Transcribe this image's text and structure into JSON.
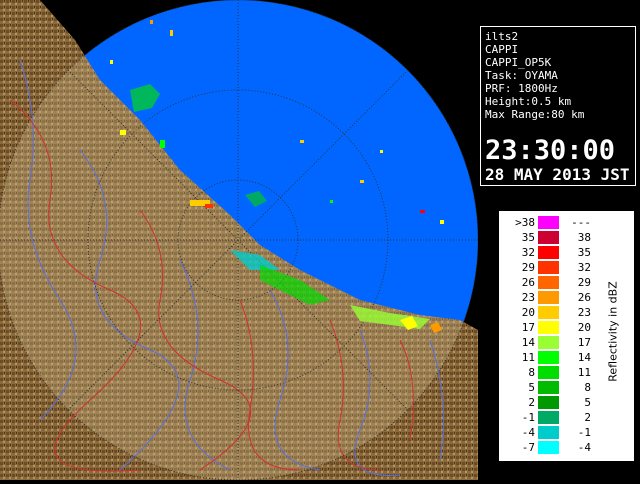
{
  "info": {
    "radar_name": "ilts2",
    "product": "CAPPI",
    "product_code": "CAPPI_OP5K",
    "task": "Task: OYAMA",
    "prf": "PRF: 1800Hz",
    "height": "Height:0.5 km",
    "max_range": "Max Range:80 km",
    "time": "23:30:00",
    "date": "28 MAY 2013 JST"
  },
  "legend": {
    "title": "Reflectivity in dBZ",
    "rows": [
      {
        "lo": ">38",
        "hi": "---",
        "color": "#ff00ff"
      },
      {
        "lo": "35",
        "hi": "38",
        "color": "#cc0033"
      },
      {
        "lo": "32",
        "hi": "35",
        "color": "#ff0000"
      },
      {
        "lo": "29",
        "hi": "32",
        "color": "#ff3300"
      },
      {
        "lo": "26",
        "hi": "29",
        "color": "#ff6600"
      },
      {
        "lo": "23",
        "hi": "26",
        "color": "#ff9900"
      },
      {
        "lo": "20",
        "hi": "23",
        "color": "#ffcc00"
      },
      {
        "lo": "17",
        "hi": "20",
        "color": "#ffff00"
      },
      {
        "lo": "14",
        "hi": "17",
        "color": "#99ff33"
      },
      {
        "lo": "11",
        "hi": "14",
        "color": "#00ff00"
      },
      {
        "lo": "8",
        "hi": "11",
        "color": "#00dd00"
      },
      {
        "lo": "5",
        "hi": "8",
        "color": "#00bb00"
      },
      {
        "lo": "2",
        "hi": "5",
        "color": "#009900"
      },
      {
        "lo": "-1",
        "hi": "2",
        "color": "#00aa66"
      },
      {
        "lo": "-4",
        "hi": "-1",
        "color": "#00cccc"
      },
      {
        "lo": "-7",
        "hi": "-4",
        "color": "#00ffff"
      }
    ]
  },
  "colors": {
    "sea_scan": "#0066ff",
    "land": "#8a6a3a",
    "outside": "#000000"
  }
}
